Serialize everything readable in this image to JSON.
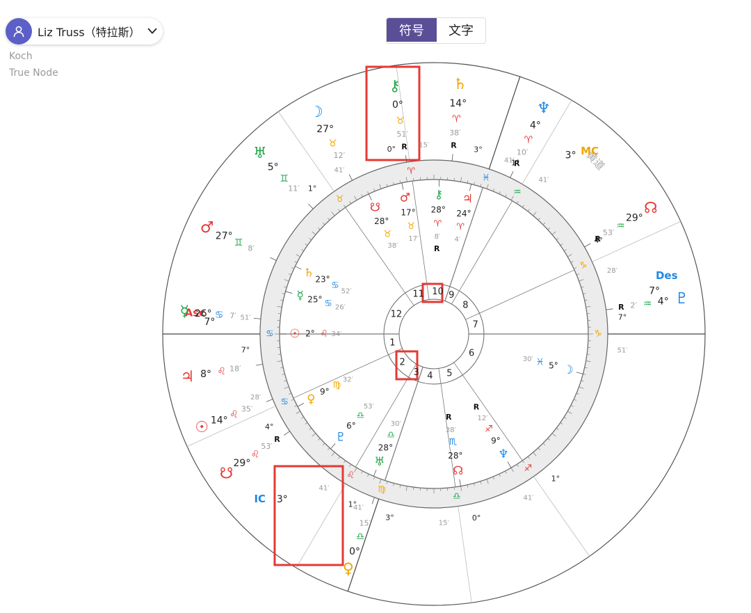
{
  "profile": {
    "name": "Liz Truss（特拉斯）"
  },
  "settings": {
    "house_system": "Koch",
    "node_type": "True Node"
  },
  "view_toggle": {
    "symbols_label": "符号",
    "text_label": "文字",
    "active": "符号"
  },
  "ecliptic_label": "黄道",
  "colors": {
    "fire": "#e53935",
    "earth": "#f0a500",
    "air": "#21a84a",
    "water": "#1e88e5",
    "accent": "#5a4f96",
    "highlight": "#e53935"
  },
  "houses": [
    "1",
    "2",
    "3",
    "4",
    "5",
    "6",
    "7",
    "8",
    "9",
    "10",
    "11",
    "12"
  ],
  "angles": [
    {
      "name": "Asc",
      "deg": "7",
      "color": "#e53935"
    },
    {
      "name": "MC",
      "deg": "3",
      "color": "#f0a500"
    },
    {
      "name": "Des",
      "deg": "7",
      "color": "#1e88e5"
    },
    {
      "name": "IC",
      "deg": "3",
      "color": "#1e88e5"
    }
  ],
  "cusps": [
    {
      "deg": "7",
      "sign": "♋",
      "min": "51",
      "color": "#1e88e5"
    },
    {
      "deg": "4",
      "sign": "♋",
      "min": "28",
      "color": "#1e88e5"
    },
    {
      "deg": "1",
      "sign": "♌",
      "min": "41",
      "color": "#e53935"
    },
    {
      "deg": "3",
      "sign": "♍",
      "min": "41",
      "color": "#f0a500"
    },
    {
      "deg": "0",
      "sign": "♎",
      "min": "15",
      "color": "#21a84a"
    },
    {
      "deg": "1",
      "sign": "♐",
      "min": "41",
      "color": "#e53935"
    },
    {
      "deg": "7",
      "sign": "♑",
      "min": "51",
      "color": "#f0a500"
    },
    {
      "deg": "4",
      "sign": "♑",
      "min": "28",
      "color": "#f0a500"
    },
    {
      "deg": "1",
      "sign": "♒",
      "min": "41",
      "color": "#21a84a"
    },
    {
      "deg": "3",
      "sign": "♓",
      "min": "41",
      "color": "#1e88e5"
    },
    {
      "deg": "0",
      "sign": "♈",
      "min": "15",
      "color": "#e53935"
    },
    {
      "deg": "1",
      "sign": "♉",
      "min": "41",
      "color": "#f0a500"
    }
  ],
  "transits": [
    {
      "glyph": "⚷",
      "deg": "0",
      "sign": "♉",
      "min": "51",
      "retro": "R",
      "color": "#21a84a",
      "sign_color": "#f0a500"
    },
    {
      "glyph": "♄",
      "deg": "14",
      "sign": "♈",
      "min": "38",
      "retro": "R",
      "color": "#f0a500",
      "sign_color": "#e53935"
    },
    {
      "glyph": "♆",
      "deg": "4",
      "sign": "♈",
      "min": "10",
      "retro": "R",
      "color": "#1e88e5",
      "sign_color": "#e53935"
    },
    {
      "glyph": "☽",
      "deg": "27",
      "sign": "♉",
      "min": "12",
      "retro": "",
      "color": "#1e88e5",
      "sign_color": "#f0a500"
    },
    {
      "glyph": "♅",
      "deg": "5",
      "sign": "♊",
      "min": "11",
      "retro": "",
      "color": "#21a84a",
      "sign_color": "#21a84a"
    },
    {
      "glyph": "♂",
      "deg": "27",
      "sign": "♊",
      "min": "8",
      "retro": "",
      "color": "#e53935",
      "sign_color": "#21a84a"
    },
    {
      "glyph": "☿",
      "deg": "26",
      "sign": "♋",
      "min": "7",
      "retro": "",
      "color": "#21a84a",
      "sign_color": "#1e88e5"
    },
    {
      "glyph": "♃",
      "deg": "8",
      "sign": "♌",
      "min": "18",
      "retro": "",
      "color": "#e53935",
      "sign_color": "#e53935"
    },
    {
      "glyph": "☉",
      "deg": "14",
      "sign": "♌",
      "min": "35",
      "retro": "",
      "color": "#e53935",
      "sign_color": "#e53935"
    },
    {
      "glyph": "☋",
      "deg": "29",
      "sign": "♌",
      "min": "53",
      "retro": "R",
      "color": "#e53935",
      "sign_color": "#e53935"
    },
    {
      "glyph": "♀",
      "deg": "0",
      "sign": "♎",
      "min": "15",
      "retro": "",
      "color": "#f0a500",
      "sign_color": "#21a84a"
    },
    {
      "glyph": "☊",
      "deg": "29",
      "sign": "♒",
      "min": "53",
      "retro": "R",
      "color": "#e53935",
      "sign_color": "#21a84a"
    },
    {
      "glyph": "♇",
      "deg": "4",
      "sign": "♒",
      "min": "2",
      "retro": "R",
      "color": "#1e88e5",
      "sign_color": "#21a84a"
    }
  ],
  "natal": [
    {
      "glyph": "☋",
      "deg": "28",
      "sign": "♉",
      "min": "38",
      "retro": "",
      "color": "#e53935",
      "sign_color": "#f0a500"
    },
    {
      "glyph": "♂",
      "deg": "17",
      "sign": "♉",
      "min": "17",
      "retro": "",
      "color": "#e53935",
      "sign_color": "#f0a500"
    },
    {
      "glyph": "⚷",
      "deg": "28",
      "sign": "♈",
      "min": "8",
      "retro": "R",
      "color": "#21a84a",
      "sign_color": "#e53935"
    },
    {
      "glyph": "♃",
      "deg": "24",
      "sign": "♈",
      "min": "4",
      "retro": "",
      "color": "#e53935",
      "sign_color": "#e53935"
    },
    {
      "glyph": "♄",
      "deg": "23",
      "sign": "♋",
      "min": "52",
      "retro": "",
      "color": "#f0a500",
      "sign_color": "#1e88e5"
    },
    {
      "glyph": "☿",
      "deg": "25",
      "sign": "♋",
      "min": "26",
      "retro": "",
      "color": "#21a84a",
      "sign_color": "#1e88e5"
    },
    {
      "glyph": "☉",
      "deg": "2",
      "sign": "♌",
      "min": "34",
      "retro": "",
      "color": "#e53935",
      "sign_color": "#e53935"
    },
    {
      "glyph": "♀",
      "deg": "9",
      "sign": "♍",
      "min": "32",
      "retro": "",
      "color": "#f0a500",
      "sign_color": "#f0a500"
    },
    {
      "glyph": "♇",
      "deg": "6",
      "sign": "♎",
      "min": "53",
      "retro": "",
      "color": "#1e88e5",
      "sign_color": "#21a84a"
    },
    {
      "glyph": "♅",
      "deg": "28",
      "sign": "♎",
      "min": "30",
      "retro": "",
      "color": "#21a84a",
      "sign_color": "#21a84a"
    },
    {
      "glyph": "☊",
      "deg": "28",
      "sign": "♏",
      "min": "38",
      "retro": "R",
      "color": "#e53935",
      "sign_color": "#1e88e5"
    },
    {
      "glyph": "♆",
      "deg": "9",
      "sign": "♐",
      "min": "12",
      "retro": "R",
      "color": "#1e88e5",
      "sign_color": "#e53935"
    },
    {
      "glyph": "☽",
      "deg": "5",
      "sign": "♓",
      "min": "30",
      "retro": "",
      "color": "#1e88e5",
      "sign_color": "#1e88e5"
    }
  ]
}
